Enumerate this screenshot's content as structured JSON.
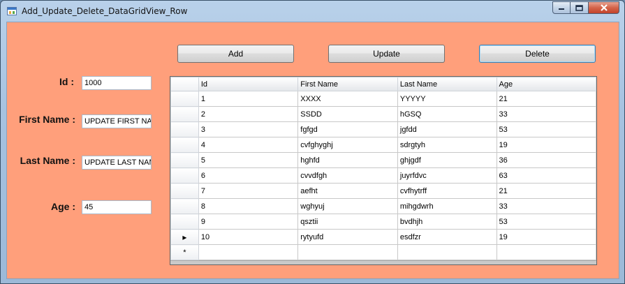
{
  "window": {
    "title": "Add_Update_Delete_DataGridView_Row",
    "controls": {
      "minimize_icon": "minimize-icon",
      "maximize_icon": "maximize-icon",
      "close_icon": "close-icon"
    }
  },
  "form": {
    "id_label": "Id :",
    "id_value": "1000",
    "first_name_label": "First Name :",
    "first_name_value": "UPDATE FIRST NAME",
    "last_name_label": "Last Name :",
    "last_name_value": "UPDATE LAST NAME",
    "age_label": "Age :",
    "age_value": "45"
  },
  "toolbar": {
    "add_label": "Add",
    "update_label": "Update",
    "delete_label": "Delete"
  },
  "grid": {
    "columns": [
      "Id",
      "First Name",
      "Last Name",
      "Age"
    ],
    "current_row_index": 9,
    "rows": [
      [
        "1",
        "XXXX",
        "YYYYY",
        "21"
      ],
      [
        "2",
        "SSDD",
        "hGSQ",
        "33"
      ],
      [
        "3",
        "fgfgd",
        "jgfdd",
        "53"
      ],
      [
        "4",
        "cvfghyghj",
        "sdrgtyh",
        "19"
      ],
      [
        "5",
        "hghfd",
        "ghjgdf",
        "36"
      ],
      [
        "6",
        "cvvdfgh",
        "juyrfdvc",
        "63"
      ],
      [
        "7",
        "aefht",
        "cvfhytrff",
        "21"
      ],
      [
        "8",
        "wghyuj",
        "mihgdwrh",
        "33"
      ],
      [
        "9",
        "qsztii",
        "bvdhjh",
        "53"
      ],
      [
        "10",
        "rytyufd",
        "esdfzr",
        "19"
      ]
    ],
    "new_row_marker": "*",
    "current_row_marker": "▸"
  },
  "colors": {
    "form_background": "#ff9f7b",
    "titlebar": "#a6c2e0"
  }
}
